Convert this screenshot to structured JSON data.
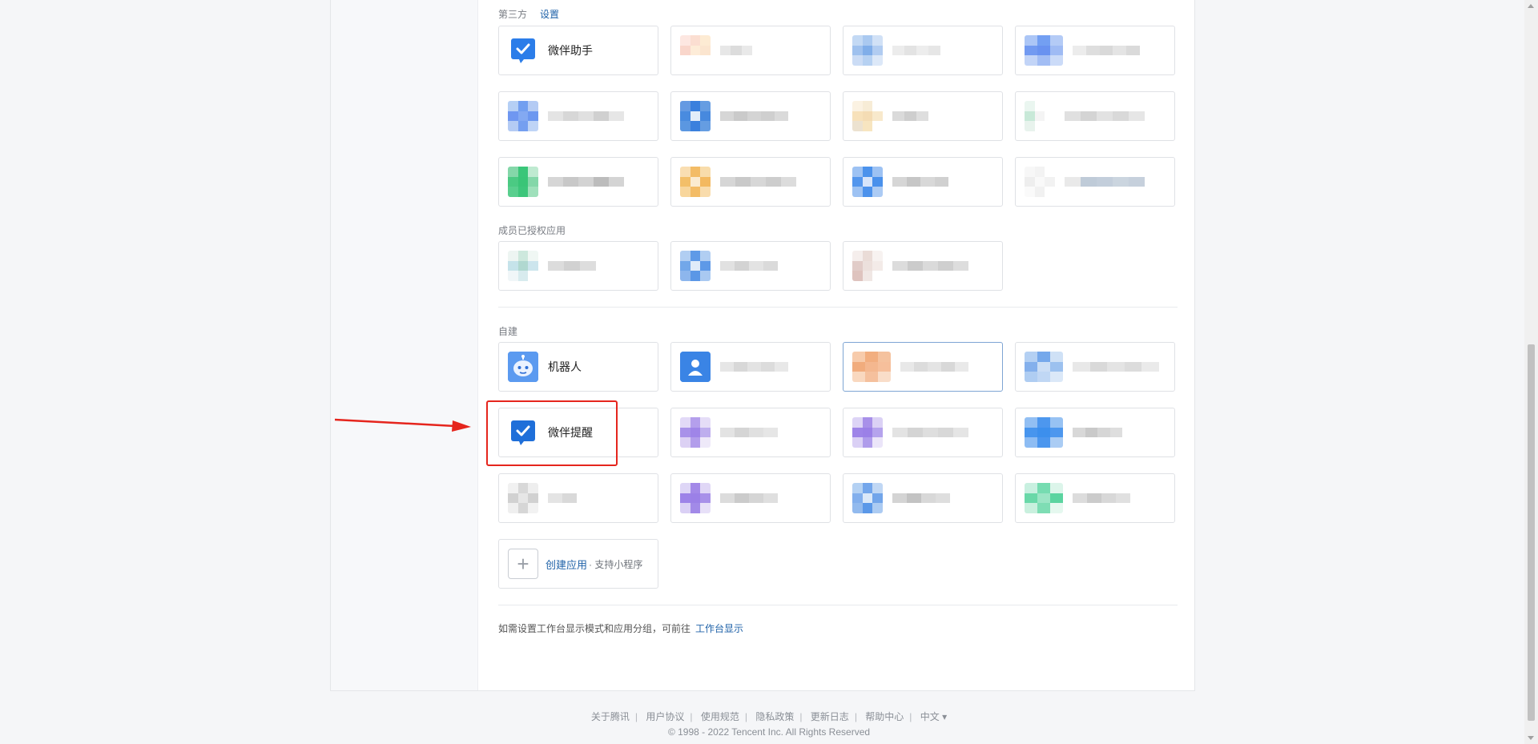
{
  "sections": {
    "third_party": {
      "title": "第三方",
      "link": "设置"
    },
    "member_authorized": {
      "title": "成员已授权应用"
    },
    "self_built": {
      "title": "自建"
    }
  },
  "apps": {
    "weiban_assistant": "微伴助手",
    "robot": "机器人",
    "weiban_reminder": "微伴提醒"
  },
  "create_app": {
    "label": "创建应用",
    "sub": "· 支持小程序"
  },
  "tip": {
    "text": "如需设置工作台显示模式和应用分组，可前往",
    "link": "工作台显示"
  },
  "footer": {
    "links": [
      "关于腾讯",
      "用户协议",
      "使用规范",
      "隐私政策",
      "更新日志",
      "帮助中心",
      "中文 ▾"
    ],
    "copyright": "© 1998 - 2022 Tencent Inc. All Rights Reserved"
  },
  "colors": {
    "accent": "#1f62a8",
    "highlight": "#e5251d"
  }
}
